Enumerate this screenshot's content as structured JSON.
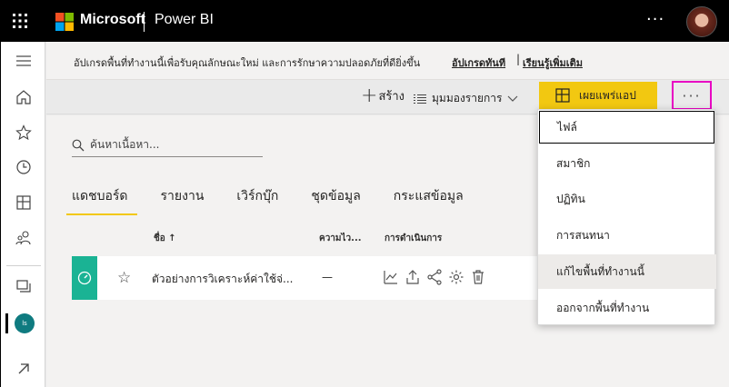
{
  "topbar": {
    "brand": "Microsoft",
    "product": "Power BI",
    "more_label": "···"
  },
  "banner": {
    "message": "อัปเกรดพื้นที่ทำงานนี้เพื่อรับคุณลักษณะใหม่ และการรักษาความปลอดภัยที่ดียิ่งขึ้น",
    "upgrade_link": "อัปเกรดทันที",
    "separator": "|",
    "learn_more_link": "เรียนรู้เพิ่มเติม"
  },
  "toolbar": {
    "create_label": "สร้าง",
    "view_label": "มุมมองรายการ",
    "publish_label": "เผยแพร่แอป",
    "more_label": "···"
  },
  "sidebar": {
    "workspace_initials": "ls"
  },
  "main": {
    "search_placeholder": "ค้นหาเนื้อหา...",
    "tabs": [
      {
        "label": "แดชบอร์ด"
      },
      {
        "label": "รายงาน"
      },
      {
        "label": "เวิร์กบุ๊ก"
      },
      {
        "label": "ชุดข้อมูล"
      },
      {
        "label": "กระแสข้อมูล"
      }
    ],
    "columns": {
      "name": "ชื่อ ↑",
      "endorsement": "ความไว...",
      "actions": "การดำเนินการ"
    },
    "rows": [
      {
        "name": "ตัวอย่างการวิเคราะห์ค่าใช้จ่...",
        "endorsement": "—"
      }
    ]
  },
  "menu": {
    "items": [
      {
        "label": "ไฟล์"
      },
      {
        "label": "สมาชิก"
      },
      {
        "label": "ปฏิทิน"
      },
      {
        "label": "การสนทนา"
      },
      {
        "label": "แก้ไขพื้นที่ทำงานนี้"
      },
      {
        "label": "ออกจากพื้นที่ทำงาน"
      }
    ]
  },
  "colors": {
    "accent": "#f2c811",
    "highlight": "#e800c3",
    "tile": "#1ab394",
    "workspace": "#0f7b80"
  }
}
